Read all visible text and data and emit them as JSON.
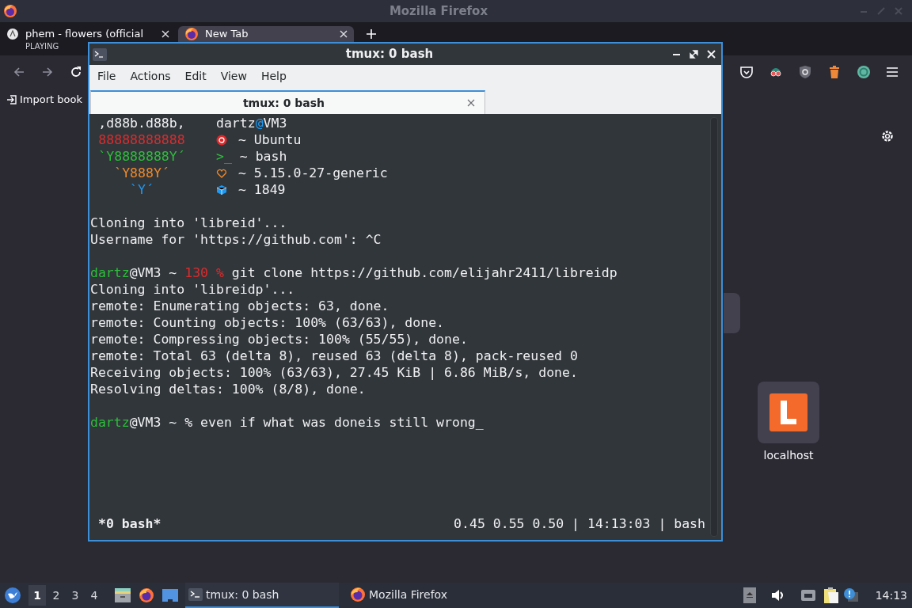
{
  "firefox": {
    "title": "Mozilla Firefox",
    "tabs": [
      {
        "title": "phem - flowers (official",
        "subtitle": "PLAYING",
        "selected": false
      },
      {
        "title": "New Tab",
        "selected": true
      }
    ],
    "bookmarks": [
      {
        "label": "Import book"
      }
    ],
    "shortcuts": [
      {
        "label": "localhost"
      }
    ]
  },
  "terminal": {
    "title": "tmux: 0 bash",
    "menu": [
      "File",
      "Actions",
      "Edit",
      "View",
      "Help"
    ],
    "tab": {
      "title": "tmux: 0 bash",
      "selected": true
    },
    "lines": [
      {
        "kind": "neofetch",
        "art": {
          "text": ",d88b.d88b,",
          "color": "#eff0f1"
        },
        "info": [
          {
            "kind": "text",
            "text": "dartz",
            "color": "#eff0f1"
          },
          {
            "kind": "text",
            "text": "@",
            "color": "#1d99f3"
          },
          {
            "kind": "text",
            "text": "VM3",
            "color": "#eff0f1"
          }
        ]
      },
      {
        "kind": "neofetch",
        "art": {
          "text": "88888888888",
          "color": "#da2c2c"
        },
        "info": [
          {
            "kind": "ubuntu_icon",
            "color": "#e0282a"
          },
          {
            "kind": "text",
            "text": " ~ Ubuntu",
            "color": "#eff0f1"
          }
        ]
      },
      {
        "kind": "neofetch",
        "art": {
          "text": "`Y8888888Y´",
          "color": "#2dbf3a"
        },
        "info": [
          {
            "kind": "text",
            "text": ">_",
            "color": "#2dbf3a"
          },
          {
            "kind": "text",
            "text": " ~ bash",
            "color": "#eff0f1"
          }
        ]
      },
      {
        "kind": "neofetch",
        "art": {
          "text": "`Y888Y´",
          "color": "#f08a2a"
        },
        "info": [
          {
            "kind": "heart_icon",
            "color": "#f08a2a"
          },
          {
            "kind": "text",
            "text": " ~ 5.15.0-27-generic",
            "color": "#eff0f1"
          }
        ]
      },
      {
        "kind": "neofetch",
        "art": {
          "text": "`Y´",
          "color": "#1d99f3"
        },
        "info": [
          {
            "kind": "package_icon",
            "color": "#1d99f3"
          },
          {
            "kind": "text",
            "text": " ~ 1849",
            "color": "#eff0f1"
          }
        ]
      },
      {
        "kind": "blank"
      },
      {
        "kind": "text",
        "segments": [
          {
            "text": "Cloning into 'libreid'...",
            "color": "#eff0f1"
          }
        ]
      },
      {
        "kind": "text",
        "segments": [
          {
            "text": "Username for 'https://github.com': ^C",
            "color": "#eff0f1"
          }
        ]
      },
      {
        "kind": "blank"
      },
      {
        "kind": "text",
        "segments": [
          {
            "text": "dartz",
            "color": "#2dbf3a"
          },
          {
            "text": "@VM3 ~ ",
            "color": "#eff0f1"
          },
          {
            "text": "130 %",
            "color": "#da2c2c"
          },
          {
            "text": " git clone https://github.com/elijahr2411/libreidp",
            "color": "#eff0f1"
          }
        ]
      },
      {
        "kind": "text",
        "segments": [
          {
            "text": "Cloning into 'libreidp'...",
            "color": "#eff0f1"
          }
        ]
      },
      {
        "kind": "text",
        "segments": [
          {
            "text": "remote: Enumerating objects: 63, done.",
            "color": "#eff0f1"
          }
        ]
      },
      {
        "kind": "text",
        "segments": [
          {
            "text": "remote: Counting objects: 100% (63/63), done.",
            "color": "#eff0f1"
          }
        ]
      },
      {
        "kind": "text",
        "segments": [
          {
            "text": "remote: Compressing objects: 100% (55/55), done.",
            "color": "#eff0f1"
          }
        ]
      },
      {
        "kind": "text",
        "segments": [
          {
            "text": "remote: Total 63 (delta 8), reused 63 (delta 8), pack-reused 0",
            "color": "#eff0f1"
          }
        ]
      },
      {
        "kind": "text",
        "segments": [
          {
            "text": "Receiving objects: 100% (63/63), 27.45 KiB | 6.86 MiB/s, done.",
            "color": "#eff0f1"
          }
        ]
      },
      {
        "kind": "text",
        "segments": [
          {
            "text": "Resolving deltas: 100% (8/8), done.",
            "color": "#eff0f1"
          }
        ]
      },
      {
        "kind": "blank"
      },
      {
        "kind": "text",
        "segments": [
          {
            "text": "dartz",
            "color": "#2dbf3a"
          },
          {
            "text": "@VM3 ~ % even if what was doneis still wrong_",
            "color": "#eff0f1"
          }
        ]
      }
    ],
    "status": {
      "left": "*0 bash*",
      "right": "0.45 0.55 0.50 | 14:13:03 | bash"
    }
  },
  "taskbar": {
    "workspaces": [
      {
        "label": "1",
        "selected": true
      },
      {
        "label": "2",
        "selected": false
      },
      {
        "label": "3",
        "selected": false
      },
      {
        "label": "4",
        "selected": false
      }
    ],
    "tasks": [
      {
        "title": "tmux: 0 bash",
        "kind": "terminal",
        "selected": true
      },
      {
        "title": "Mozilla Firefox",
        "kind": "browser",
        "selected": false
      }
    ],
    "clock": "14:13"
  }
}
